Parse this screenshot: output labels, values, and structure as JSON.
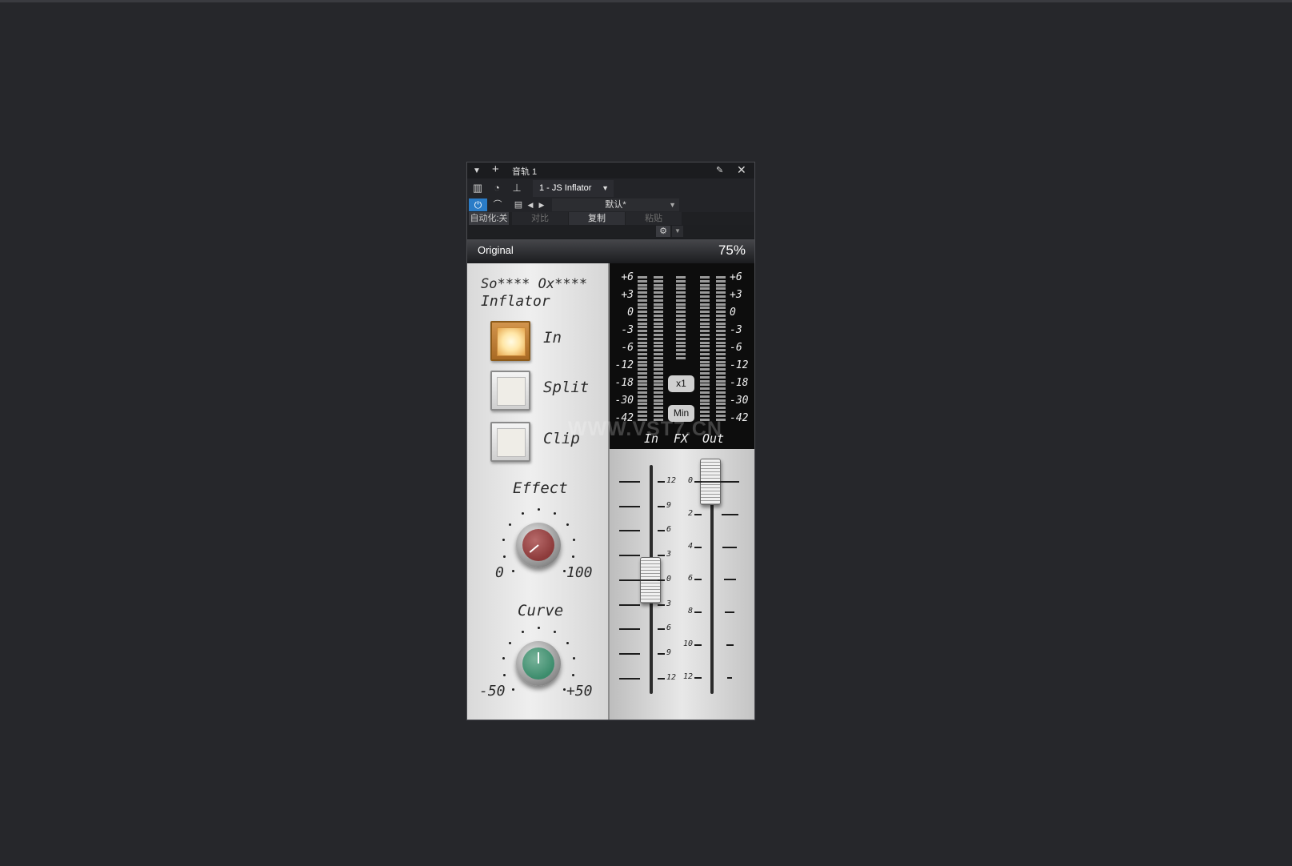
{
  "window": {
    "title": "音轨 1",
    "plugin_select": "1 - JS Inflator",
    "preset": "默认*",
    "automation": "自动化:关",
    "compare": "对比",
    "copy": "复制",
    "paste": "粘贴"
  },
  "plugin": {
    "preset_name": "Original",
    "zoom": "75%",
    "title_line1": "So**** Ox****",
    "title_line2": "Inflator",
    "buttons": [
      {
        "label": "In",
        "on": true
      },
      {
        "label": "Split",
        "on": false
      },
      {
        "label": "Clip",
        "on": false
      }
    ],
    "effect": {
      "label": "Effect",
      "min": "0",
      "max": "100",
      "color": "#8c3a3a"
    },
    "curve": {
      "label": "Curve",
      "min": "-50",
      "max": "+50",
      "color": "#3c8c6c"
    },
    "meter": {
      "scale": [
        "+6",
        "+3",
        "0",
        "-3",
        "-6",
        "-12",
        "-18",
        "-30",
        "-42"
      ],
      "x1": "x1",
      "min": "Min",
      "labels": [
        "In",
        "FX",
        "Out"
      ]
    },
    "input_fader": {
      "scale": [
        "12",
        "9",
        "6",
        "3",
        "0",
        "3",
        "6",
        "9",
        "12"
      ],
      "value_db": 0
    },
    "output_fader": {
      "scale": [
        "0",
        "2",
        "4",
        "6",
        "8",
        "10",
        "12"
      ],
      "value_db": 0
    }
  },
  "watermark": "WWW.VST7.CN"
}
